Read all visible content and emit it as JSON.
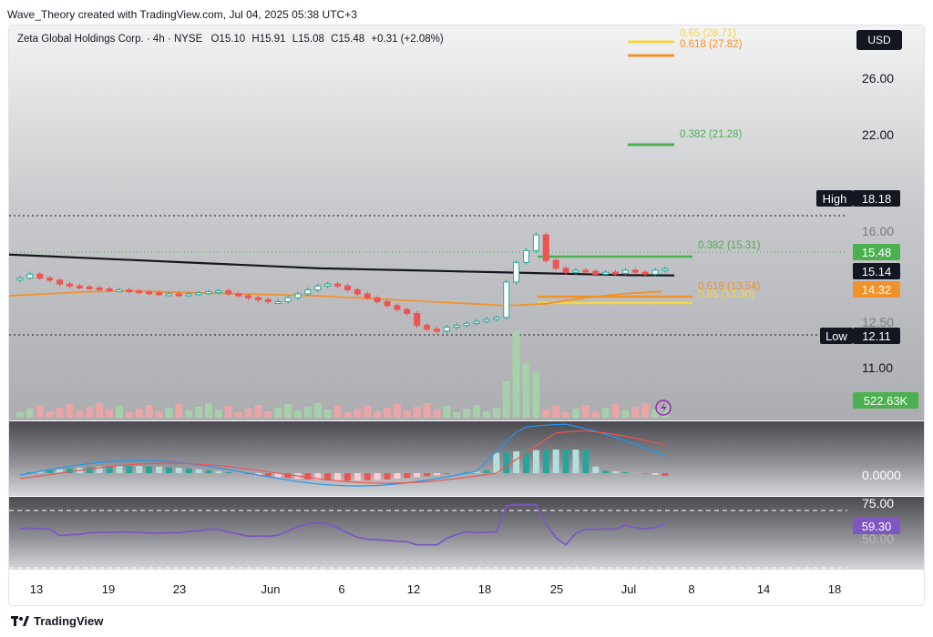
{
  "header": {
    "attribution": "Wave_Theory created with TradingView.com, Jul 04, 2025 05:38 UTC+3"
  },
  "symbol_line": {
    "name": "Zeta Global Holdings Corp. · 4h · NYSE",
    "o_label": "O",
    "o_value": "15.10",
    "h_label": "H",
    "h_value": "15.91",
    "l_label": "L",
    "l_value": "15.08",
    "c_label": "C",
    "c_value": "15.48",
    "change": "+0.31 (+2.08%)"
  },
  "currency": "USD",
  "price_axis": {
    "labels": [
      "26.00",
      "22.00",
      "16.00",
      "12.50",
      "11.00"
    ]
  },
  "markers": {
    "high_label": "High",
    "high_value": "18.18",
    "low_label": "Low",
    "low_value": "12.11",
    "last_price": "15.48",
    "ma200": "15.14",
    "ma50": "14.32",
    "volume": "522.63K"
  },
  "fib_levels": [
    {
      "label": "0.65 (28.71)",
      "color": "#f5d742"
    },
    {
      "label": "0.618 (27.82)",
      "color": "#f0922b"
    },
    {
      "label": "0.382 (21.28)",
      "color": "#4caf50"
    },
    {
      "label": "0.382 (15.31)",
      "color": "#4caf50"
    },
    {
      "label": "0.618 (13.54)",
      "color": "#f0922b"
    },
    {
      "label": "0.65 (13.30)",
      "color": "#f5d742"
    }
  ],
  "macd": {
    "zero_label": "0.0000"
  },
  "rsi": {
    "level_label": "75.00",
    "value": "59.30",
    "low_label": "50.00"
  },
  "x_axis": {
    "labels": [
      "13",
      "19",
      "23",
      "Jun",
      "6",
      "12",
      "18",
      "25",
      "Jul",
      "8",
      "14",
      "18"
    ]
  },
  "colors": {
    "up": "#26a69a",
    "down": "#ef5350",
    "ma200": "#131722",
    "ma50": "#f0922b",
    "rsi": "#7e57c2",
    "macd_line": "#2196f3",
    "signal_line": "#ef5350"
  },
  "footer": {
    "brand": "TradingView"
  },
  "chart_data": {
    "type": "candlestick",
    "timeframe": "4h",
    "currency": "USD",
    "ohlc_last": {
      "open": 15.1,
      "high": 15.91,
      "low": 15.08,
      "close": 15.48
    },
    "series": [
      {
        "name": "price",
        "values": [
          15.0,
          15.2,
          15.0,
          14.9,
          14.7,
          14.6,
          14.55,
          14.5,
          14.45,
          14.4,
          14.4,
          14.35,
          14.3,
          14.25,
          14.2,
          14.2,
          14.15,
          14.2,
          14.25,
          14.3,
          14.35,
          14.2,
          14.1,
          14.0,
          13.9,
          13.8,
          13.8,
          14.0,
          14.2,
          14.4,
          14.6,
          14.7,
          14.6,
          14.4,
          14.2,
          14.0,
          13.8,
          13.6,
          13.4,
          13.2,
          12.6,
          12.4,
          12.3,
          12.5,
          12.6,
          12.7,
          12.8,
          12.9,
          13.0,
          14.8,
          15.8,
          16.4,
          17.2,
          15.9,
          15.5,
          15.3,
          15.4,
          15.35,
          15.2,
          15.3,
          15.25,
          15.4,
          15.3,
          15.2,
          15.4,
          15.48
        ]
      },
      {
        "name": "ma200",
        "values": [
          16.2,
          16.1,
          16.0,
          15.9,
          15.8,
          15.7,
          15.6,
          15.5,
          15.45,
          15.4,
          15.35,
          15.3,
          15.25,
          15.2,
          15.15,
          15.14
        ]
      },
      {
        "name": "ma50",
        "values": [
          14.1,
          14.2,
          14.3,
          14.35,
          14.3,
          14.25,
          14.2,
          14.15,
          14.1,
          14.0,
          13.9,
          13.8,
          13.7,
          13.6,
          13.7,
          14.0,
          14.2,
          14.32
        ]
      }
    ],
    "x_ticks": [
      "13",
      "19",
      "23",
      "Jun",
      "6",
      "12",
      "18",
      "25",
      "Jul",
      "8",
      "14",
      "18"
    ],
    "y_ticks": [
      26.0,
      22.0,
      16.0,
      12.5,
      11.0
    ],
    "annotations": {
      "high": 18.18,
      "low": 12.11,
      "last": 15.48,
      "ma200": 15.14,
      "ma50": 14.32,
      "volume": "522.63K",
      "rsi": 59.3
    },
    "fib": [
      [
        "0.65",
        28.71
      ],
      [
        "0.618",
        27.82
      ],
      [
        "0.382",
        21.28
      ],
      [
        "0.382",
        15.31
      ],
      [
        "0.618",
        13.54
      ],
      [
        "0.65",
        13.3
      ]
    ]
  }
}
